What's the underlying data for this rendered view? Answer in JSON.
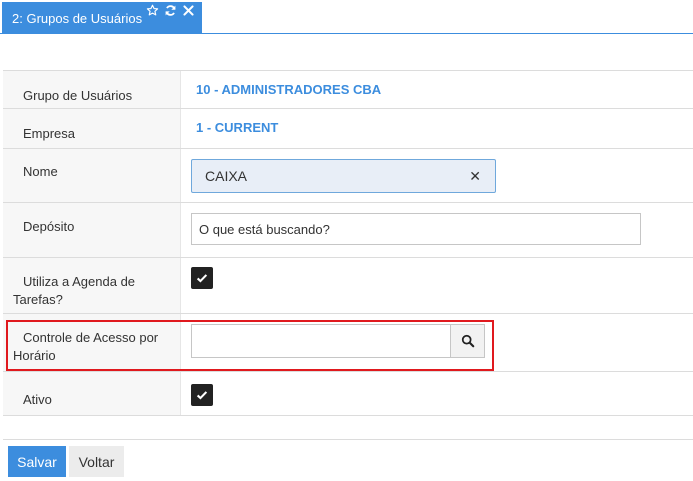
{
  "tab": {
    "title": "2: Grupos de Usuários",
    "icons": [
      "star-icon",
      "refresh-icon",
      "close-icon"
    ]
  },
  "form": {
    "grupo": {
      "label": "Grupo de Usuários",
      "value": "10 - ADMINISTRADORES CBA"
    },
    "empresa": {
      "label": "Empresa",
      "value": "1 - CURRENT"
    },
    "nome": {
      "label": "Nome",
      "value": "CAIXA",
      "clear": "✕"
    },
    "deposito": {
      "label": "Depósito",
      "placeholder": "O que está buscando?"
    },
    "agenda": {
      "label_line1": "Utiliza a Agenda de",
      "label_line2": "Tarefas?",
      "checked": true
    },
    "controle": {
      "label_line1": "Controle de Acesso por",
      "label_line2": "Horário",
      "value": ""
    },
    "ativo": {
      "label": "Ativo",
      "checked": true
    }
  },
  "buttons": {
    "save": "Salvar",
    "back": "Voltar"
  },
  "colors": {
    "accent": "#3c8dde",
    "highlight": "#e0191e",
    "checkbox": "#222222"
  }
}
